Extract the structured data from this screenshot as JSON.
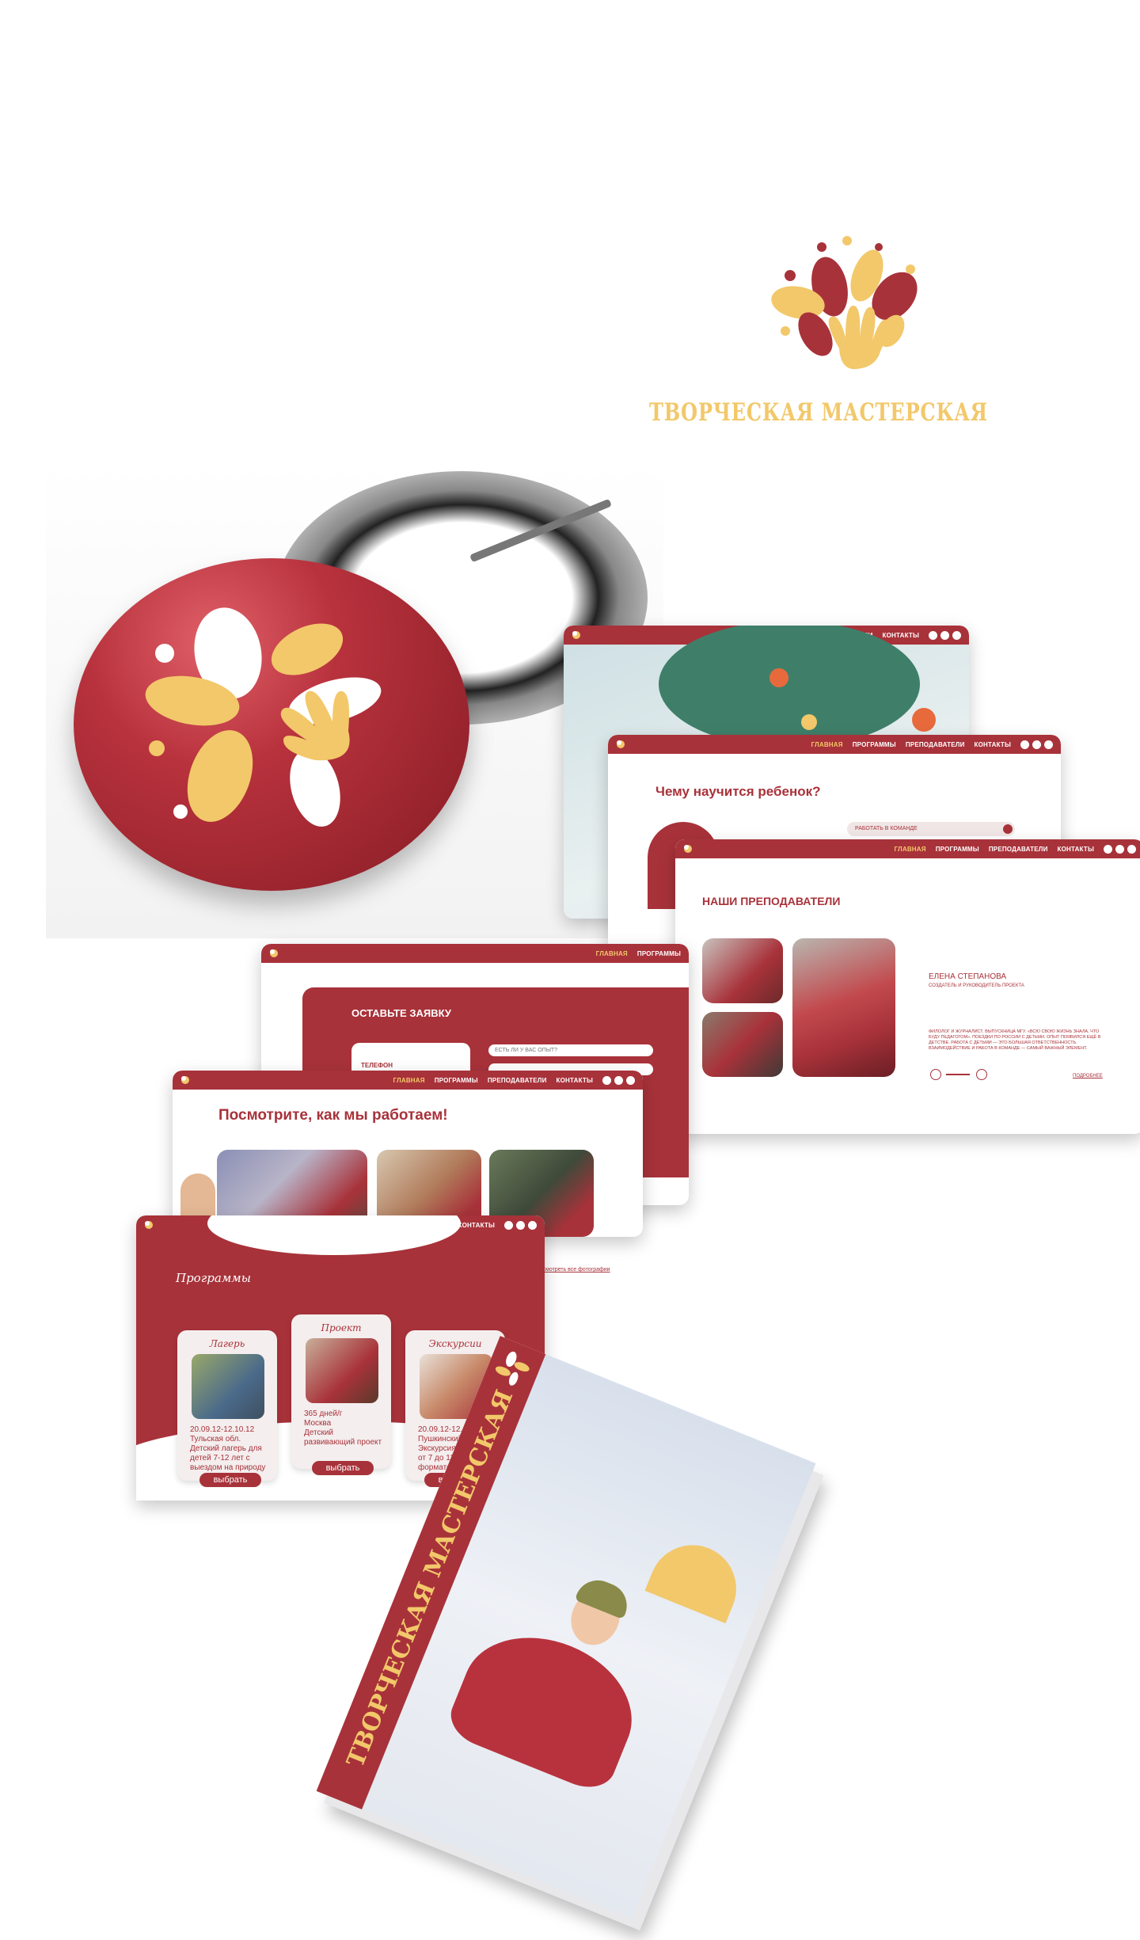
{
  "brand": {
    "logo_text": "ТВОРЧЕСКАЯ МАСТЕРСКАЯ",
    "color_primary": "#a8323a",
    "color_accent": "#f2c86a",
    "logo_icon": "flower-hand-icon"
  },
  "nav": {
    "home": "ГЛАВНАЯ",
    "programs": "ПРОГРАММЫ",
    "teachers": "ПРЕПОДАВАТЕЛИ",
    "contacts": "КОНТАКТЫ"
  },
  "skills_page": {
    "title": "Чему научится ребенок?",
    "select_value": "РАБОТАТЬ В КОМАНДЕ"
  },
  "teachers_page": {
    "title": "НАШИ ПРЕПОДАВАТЕЛИ",
    "teacher_name": "ЕЛЕНА СТЕПАНОВА",
    "teacher_role": "СОЗДАТЕЛЬ И РУКОВОДИТЕЛЬ ПРОЕКТА",
    "teacher_bio": "ФИЛОЛОГ И ЖУРНАЛИСТ. ВЫПУСКНИЦА МГУ. «ВСЮ СВОЮ ЖИЗНЬ ЗНАЛА, ЧТО БУДУ ПЕДАГОГОМ». ПОЕЗДКИ ПО РОССИИ С ДЕТЬМИ. ОПЫТ ПОЯВИЛСЯ ЕЩЁ В ДЕТСТВЕ. РАБОТА С ДЕТЬМИ — ЭТО БОЛЬШАЯ ОТВЕТСТВЕННОСТЬ. ВЗАИМОДЕЙСТВИЕ И РАБОТА В КОМАНДЕ — САМЫЙ ВАЖНЫЙ ЭЛЕМЕНТ.",
    "more_link": "ПОДРОБНЕЕ"
  },
  "request_page": {
    "title": "ОСТАВЬТЕ ЗАЯВКУ",
    "phone_label": "ТЕЛЕФОН",
    "question_placeholder": "ЕСТЬ ЛИ У ВАС ОПЫТ?"
  },
  "works_page": {
    "title": "Посмотрите, как мы работаем!",
    "all_photos_link": "Смотреть все фотографии"
  },
  "programs_page": {
    "title": "Программы",
    "cards": [
      {
        "title": "Лагерь",
        "date": "20.09.12-12.10.12",
        "place": "Тульская обл.",
        "desc": "Детский лагерь для детей 7-12 лет с выездом на природу",
        "button": "выбрать"
      },
      {
        "title": "Проект",
        "date": "365 дней/г",
        "place": "Москва",
        "desc": "Детский развивающий проект",
        "button": "выбрать"
      },
      {
        "title": "Экскурсии",
        "date": "20.09.12-12.10.12",
        "place": "Пушкинский музей",
        "desc": "Экскурсия для детей от 7 до 12 лет в формате квеста",
        "button": "выбрать"
      }
    ]
  },
  "book": {
    "cover_text": "ТВОРЧЕСКАЯ МАСТЕРСКАЯ"
  }
}
